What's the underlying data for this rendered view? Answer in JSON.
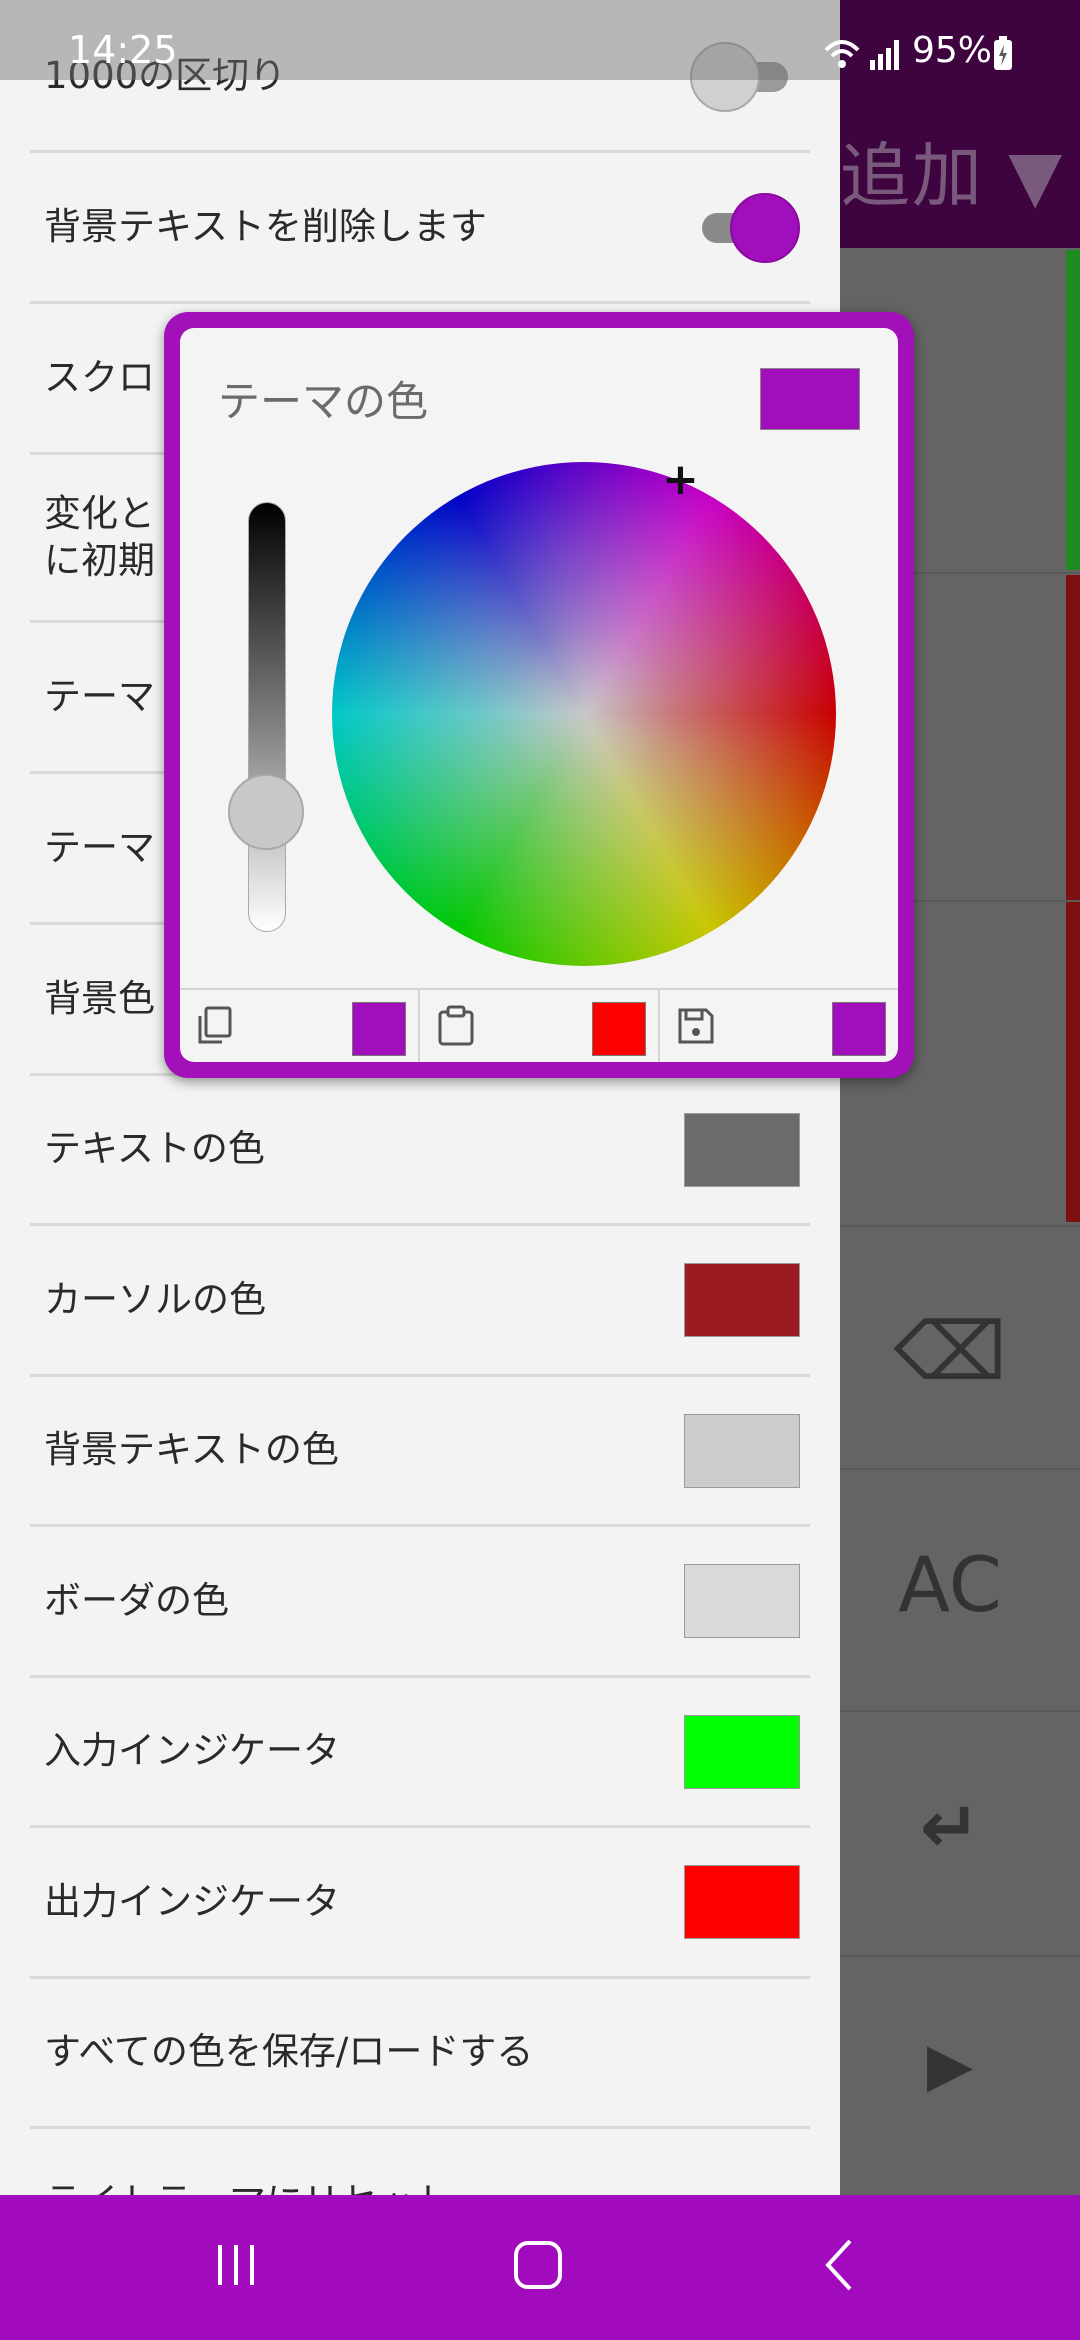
{
  "status_bar": {
    "time": "14:25",
    "battery": "95%"
  },
  "background_app": {
    "header_text": "追加 ▼",
    "keys": {
      "backspace": "⌫",
      "clear": "AC",
      "enter": "↵",
      "play": "▶"
    }
  },
  "settings": {
    "rows": [
      {
        "label": "1000の区切り",
        "type": "toggle",
        "on": false
      },
      {
        "label": "背景テキストを削除します",
        "type": "toggle",
        "on": true
      },
      {
        "label": "スクロ"
      },
      {
        "label": "変化と\nに初期"
      },
      {
        "label": "テーマ"
      },
      {
        "label": "テーマ"
      },
      {
        "label": "背景色"
      },
      {
        "label": "テキストの色",
        "color": "#6b6b6b"
      },
      {
        "label": "カーソルの色",
        "color": "#9b1b22"
      },
      {
        "label": "背景テキストの色",
        "color": "#cccccc"
      },
      {
        "label": "ボーダの色",
        "color": "#d9d9d9"
      },
      {
        "label": "入力インジケータ",
        "color": "#00ff00"
      },
      {
        "label": "出力インジケータ",
        "color": "#ff0000"
      },
      {
        "label": "すべての色を保存/ロードする"
      },
      {
        "label": "ライトテーマにリセット"
      }
    ]
  },
  "color_picker": {
    "title": "テーマの色",
    "current_color": "#a10fbd",
    "accent_color": "#a110b8",
    "brightness_level": 0.72,
    "bottom": [
      {
        "icon": "copy-icon",
        "color": "#a10fbd"
      },
      {
        "icon": "paste-icon",
        "color": "#ff0000"
      },
      {
        "icon": "save-icon",
        "color": "#a10fbd"
      }
    ]
  },
  "nav_bar": {
    "color": "#a10bbd",
    "icons": [
      "recents-icon",
      "home-icon",
      "back-icon"
    ]
  }
}
